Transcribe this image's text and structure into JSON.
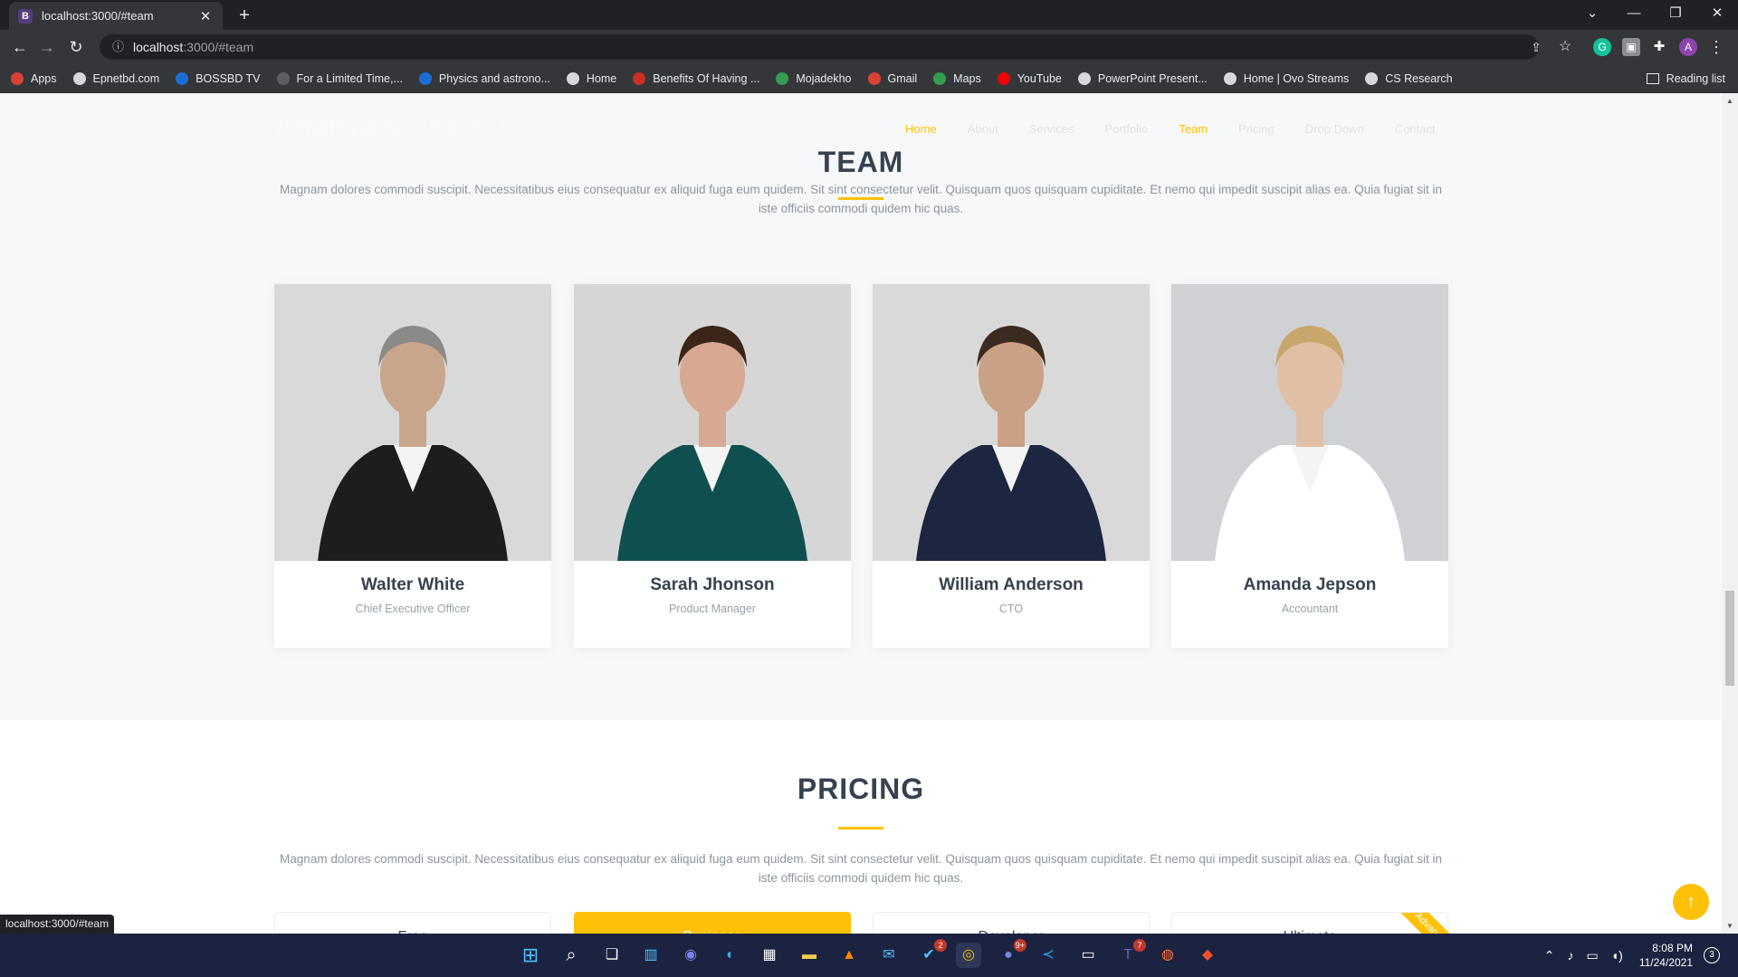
{
  "browser": {
    "tab_title": "localhost:3000/#team",
    "tab_favicon": "B",
    "url_host": "localhost",
    "url_path": ":3000/#team",
    "profile_initial": "A",
    "status_url": "localhost:3000/#team"
  },
  "bookmarks": [
    {
      "label": "Apps",
      "icon": "apps-grid-icon",
      "color": "#e94235"
    },
    {
      "label": "Epnetbd.com",
      "icon": "globe-icon",
      "color": "#e8eaed"
    },
    {
      "label": "BOSSBD TV",
      "icon": "tv-icon",
      "color": "#1a73e8"
    },
    {
      "label": "For a Limited Time,...",
      "icon": "page-icon",
      "color": "#5f6368"
    },
    {
      "label": "Physics and astrono...",
      "icon": "page-icon",
      "color": "#1a73e8"
    },
    {
      "label": "Home",
      "icon": "globe-icon",
      "color": "#e8eaed"
    },
    {
      "label": "Benefits Of Having ...",
      "icon": "page-icon",
      "color": "#d93025"
    },
    {
      "label": "Mojadekho",
      "icon": "diamond-icon",
      "color": "#34a853"
    },
    {
      "label": "Gmail",
      "icon": "gmail-icon",
      "color": "#ea4335"
    },
    {
      "label": "Maps",
      "icon": "maps-icon",
      "color": "#34a853"
    },
    {
      "label": "YouTube",
      "icon": "youtube-icon",
      "color": "#ff0000"
    },
    {
      "label": "PowerPoint Present...",
      "icon": "globe-icon",
      "color": "#e8eaed"
    },
    {
      "label": "Home | Ovo Streams",
      "icon": "globe-icon",
      "color": "#e8eaed"
    },
    {
      "label": "CS Research",
      "icon": "globe-icon",
      "color": "#e8eaed"
    }
  ],
  "reading_list": "Reading list",
  "site": {
    "logo": "Ananya's Project",
    "nav": [
      "Home",
      "About",
      "Services",
      "Portfolio",
      "Team",
      "Pricing",
      "Drop Down",
      "Contact"
    ],
    "active_nav": "Team",
    "accent": "#ffc107"
  },
  "team": {
    "title": "TEAM",
    "description": "Magnam dolores commodi suscipit. Necessitatibus eius consequatur ex aliquid fuga eum quidem. Sit sint consectetur velit. Quisquam quos quisquam cupiditate. Et nemo qui impedit suscipit alias ea. Quia fugiat sit in iste officiis commodi quidem hic quas.",
    "members": [
      {
        "name": "Walter White",
        "role": "Chief Executive Officer"
      },
      {
        "name": "Sarah Jhonson",
        "role": "Product Manager"
      },
      {
        "name": "William Anderson",
        "role": "CTO"
      },
      {
        "name": "Amanda Jepson",
        "role": "Accountant"
      }
    ]
  },
  "pricing": {
    "title": "PRICING",
    "description": "Magnam dolores commodi suscipit. Necessitatibus eius consequatur ex aliquid fuga eum quidem. Sit sint consectetur velit. Quisquam quos quisquam cupiditate. Et nemo qui impedit suscipit alias ea. Quia fugiat sit in iste officiis commodi quidem hic quas.",
    "plans": [
      "Free",
      "Business",
      "Developer",
      "Ultimate"
    ],
    "ribbon": "Advanced"
  },
  "taskbar": {
    "time": "8:08 PM",
    "date": "11/24/2021",
    "notifications": "3",
    "badges": {
      "todo": "2",
      "discord": "9+",
      "teams": "7"
    }
  }
}
